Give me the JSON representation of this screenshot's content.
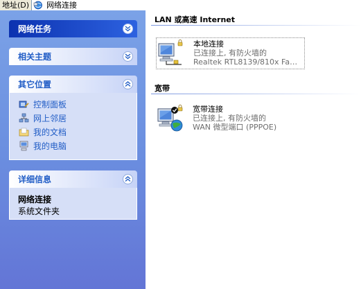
{
  "address_bar": {
    "label": "地址(D)",
    "value": "网络连接"
  },
  "task_pane": {
    "network_tasks": {
      "title": "网络任务",
      "collapsed": true
    },
    "related_topics": {
      "title": "相关主题",
      "collapsed": true
    },
    "other_places": {
      "title": "其它位置",
      "items": [
        {
          "label": "控制面板",
          "icon": "control-panel-icon"
        },
        {
          "label": "网上邻居",
          "icon": "network-places-icon"
        },
        {
          "label": "我的文档",
          "icon": "my-documents-icon"
        },
        {
          "label": "我的电脑",
          "icon": "my-computer-icon"
        }
      ]
    },
    "details": {
      "title": "详细信息",
      "name": "网络连接",
      "type": "系统文件夹"
    }
  },
  "content": {
    "groups": [
      {
        "title": "LAN 或高速 Internet",
        "connections": [
          {
            "name": "本地连接",
            "status": "已连接上, 有防火墙的",
            "device": "Realtek RTL8139/810x Family ...",
            "selected": true
          }
        ]
      },
      {
        "title": "宽带",
        "connections": [
          {
            "name": "宽带连接",
            "status": "已连接上, 有防火墙的",
            "device": "WAN 微型端口 (PPPOE)",
            "selected": false
          }
        ]
      }
    ]
  },
  "colors": {
    "task_pane_bg": "#6b8fe0",
    "panel_head_dark": "#0c32b0",
    "link": "#215dc6",
    "panel_body": "#d6dff7"
  }
}
